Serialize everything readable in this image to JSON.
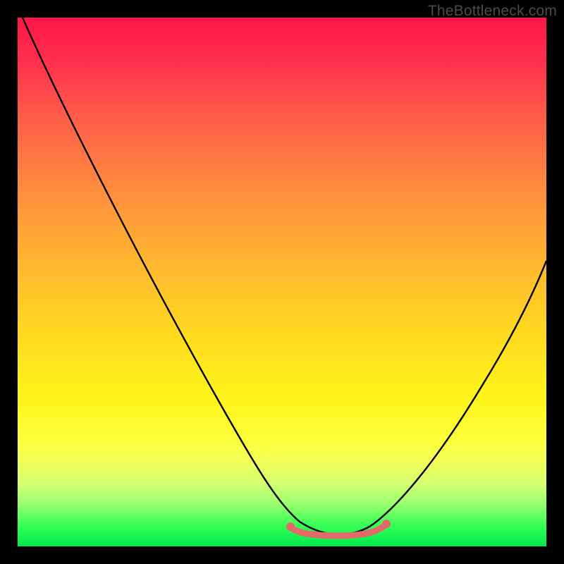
{
  "watermark": {
    "text": "TheBottleneck.com"
  },
  "chart_data": {
    "type": "line",
    "title": "",
    "xlabel": "",
    "ylabel": "",
    "xlim": [
      0,
      100
    ],
    "ylim": [
      0,
      100
    ],
    "grid": false,
    "legend": false,
    "series": [
      {
        "name": "curve",
        "x": [
          0,
          5,
          10,
          15,
          20,
          25,
          30,
          35,
          40,
          45,
          50,
          52,
          55,
          58,
          60,
          62,
          64,
          66,
          68,
          70,
          74,
          78,
          82,
          86,
          90,
          94,
          98,
          100
        ],
        "y": [
          100,
          90,
          80,
          70,
          60,
          50,
          41,
          32,
          23,
          15,
          8,
          6,
          4,
          3,
          2.5,
          2,
          2,
          2.5,
          3,
          4,
          7,
          12,
          19,
          27,
          36,
          46,
          57,
          63
        ]
      }
    ],
    "flat_zone": {
      "x_range": [
        51,
        70
      ],
      "y": 2.3,
      "endpoint_dots": true,
      "color": "#e46a6a"
    },
    "background_gradient": {
      "direction": "vertical",
      "stops": [
        {
          "pos": 0,
          "color": "#ff1648"
        },
        {
          "pos": 50,
          "color": "#ffc628"
        },
        {
          "pos": 80,
          "color": "#fdff3b"
        },
        {
          "pos": 100,
          "color": "#00e84e"
        }
      ]
    }
  }
}
